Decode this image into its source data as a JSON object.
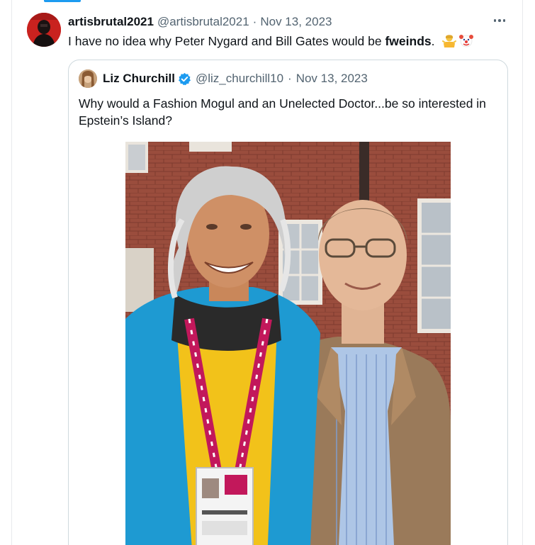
{
  "tweet": {
    "display_name": "artisbrutal2021",
    "handle": "@artisbrutal2021",
    "separator": "·",
    "date": "Nov 13, 2023",
    "text_before": "I have no idea why Peter Nygard and Bill Gates would be ",
    "text_bold": "fweinds",
    "text_after": ".",
    "emojis": [
      "person-shrugging-emoji",
      "clown-face-emoji"
    ],
    "more_icon": "more-icon"
  },
  "quote": {
    "display_name": "Liz Churchill",
    "verified_icon": "verified-badge-icon",
    "handle": "@liz_churchill10",
    "separator": "·",
    "date": "Nov 13, 2023",
    "text": "Why would a Fashion Mogul and an Unelected Doctor...be so interested in Epstein’s Island?"
  },
  "colors": {
    "accent": "#1d9bf0",
    "text_primary": "#0f1419",
    "text_secondary": "#536471",
    "border": "#cfd9de"
  }
}
